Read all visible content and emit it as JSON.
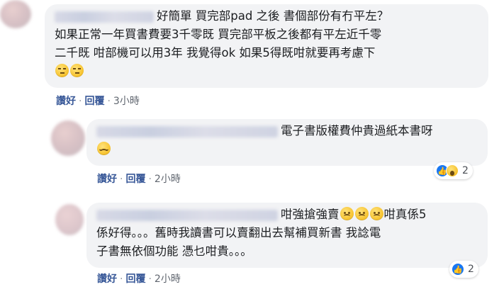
{
  "comments": [
    {
      "text_lines": [
        "好簡單 買完部pad 之後 書個部份有冇平左？",
        "如果正常一年買書費要3千零既 買完部平板之後都有平左近千零",
        "二千既 咁部機可以用3年 我覺得ok 如果5得既咁就要再考慮下"
      ],
      "trailing_emojis": [
        "thinking-face",
        "thinking-face"
      ],
      "actions": {
        "like": "讚好",
        "reply": "回覆",
        "time": "3小時"
      }
    },
    {
      "text_lines": [
        "電子書版權費仲貴過紙本書呀"
      ],
      "trailing_emojis": [
        "relieved-face"
      ],
      "actions": {
        "like": "讚好",
        "reply": "回覆",
        "time": "2小時"
      },
      "reactions": {
        "icons": [
          "like",
          "wow"
        ],
        "count": "2"
      }
    },
    {
      "text_lines": [
        "咁強搶強賣",
        "咁真係5",
        "係好得。。。舊時我讀書可以賣翻出去幫補買新書 我諗電",
        "子書無依個功能 憑乜咁貴。。。"
      ],
      "inline_emojis": [
        "sad-face",
        "sad-face",
        "sad-face"
      ],
      "actions": {
        "like": "讚好",
        "reply": "回覆",
        "time": "2小時"
      },
      "reactions": {
        "icons": [
          "like"
        ],
        "count": "2"
      }
    }
  ],
  "separator": "·",
  "colors": {
    "bubble": "#f2f3f5",
    "link": "#385898",
    "like_blue": "#1877f2"
  }
}
